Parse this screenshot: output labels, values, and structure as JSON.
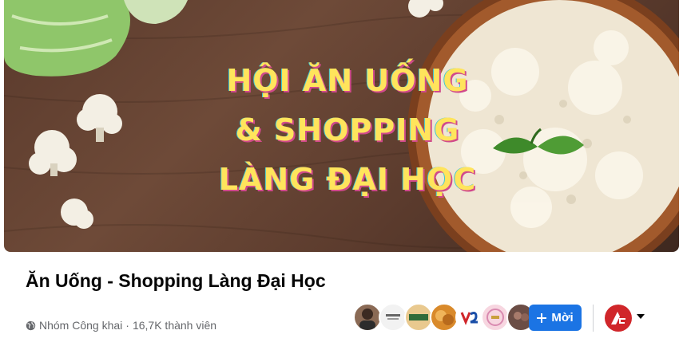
{
  "cover": {
    "title_lines": [
      "HỘI ĂN UỐNG",
      "& SHOPPING",
      "LÀNG ĐẠI HỌC"
    ]
  },
  "group": {
    "name": "Ăn Uống - Shopping Làng Đại Học",
    "privacy": "Nhóm Công khai",
    "separator": "·",
    "members": "16,7K thành viên"
  },
  "member_avatars": [
    {
      "icon": "member-avatar-1",
      "color": "#8a6a55"
    },
    {
      "icon": "member-avatar-2",
      "color": "#f2f2f2"
    },
    {
      "icon": "member-avatar-3",
      "color": "#e9c98f"
    },
    {
      "icon": "member-avatar-4",
      "color": "#d98a2b"
    },
    {
      "icon": "member-avatar-5",
      "color": "#ffffff"
    },
    {
      "icon": "member-avatar-6",
      "color": "#f7d6e0"
    },
    {
      "icon": "member-avatar-7",
      "color": "#6b4d45"
    }
  ],
  "actions": {
    "invite_label": "Mời",
    "invite_icon": "plus-icon"
  },
  "colors": {
    "accent": "#1b74e4",
    "title_text": "#ffe45c"
  }
}
